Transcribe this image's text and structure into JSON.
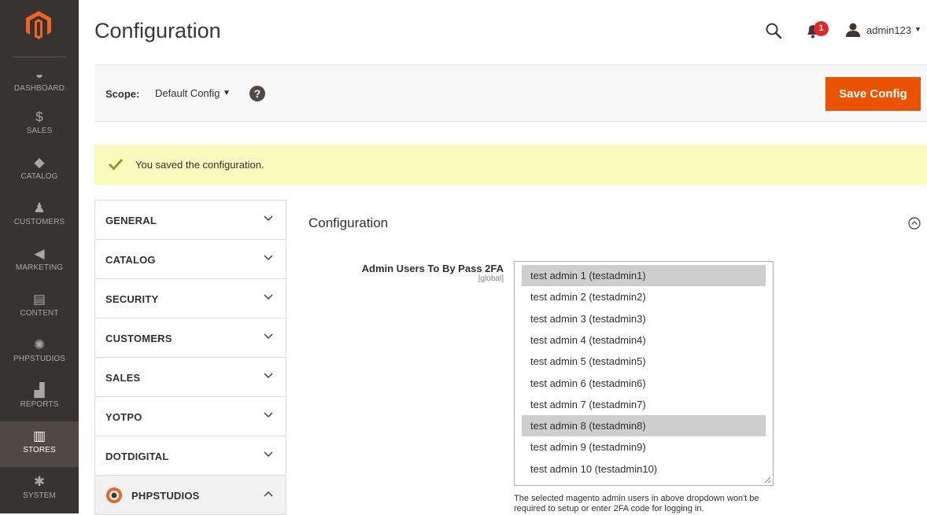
{
  "sidebar": {
    "logo": "magento-logo",
    "items": [
      {
        "label": "DASHBOARD",
        "icon": "dashboard-icon",
        "glyph": "◒"
      },
      {
        "label": "SALES",
        "icon": "dollar-icon",
        "glyph": "$"
      },
      {
        "label": "CATALOG",
        "icon": "box-icon",
        "glyph": "◆"
      },
      {
        "label": "CUSTOMERS",
        "icon": "person-icon",
        "glyph": "♟"
      },
      {
        "label": "MARKETING",
        "icon": "megaphone-icon",
        "glyph": "◀"
      },
      {
        "label": "CONTENT",
        "icon": "layout-icon",
        "glyph": "▤"
      },
      {
        "label": "PHPSTUDIOS",
        "icon": "phpstudios-icon",
        "glyph": "✺"
      },
      {
        "label": "REPORTS",
        "icon": "bar-chart-icon",
        "glyph": "▟"
      },
      {
        "label": "STORES",
        "icon": "store-icon",
        "glyph": "▥"
      },
      {
        "label": "SYSTEM",
        "icon": "gear-icon",
        "glyph": "✱"
      }
    ],
    "active": "STORES"
  },
  "header": {
    "title": "Configuration",
    "notification_count": "1",
    "username": "admin123"
  },
  "scope_bar": {
    "scope_label": "Scope:",
    "scope_value": "Default Config",
    "help_glyph": "?",
    "save_label": "Save Config"
  },
  "message": {
    "text": "You saved the configuration."
  },
  "tabs": [
    {
      "label": "GENERAL",
      "open": false
    },
    {
      "label": "CATALOG",
      "open": false
    },
    {
      "label": "SECURITY",
      "open": false
    },
    {
      "label": "CUSTOMERS",
      "open": false
    },
    {
      "label": "SALES",
      "open": false
    },
    {
      "label": "YOTPO",
      "open": false
    },
    {
      "label": "DOTDIGITAL",
      "open": false
    },
    {
      "label": "PHPSTUDIOS",
      "open": true
    }
  ],
  "section": {
    "title": "Configuration",
    "field_label": "Admin Users To By Pass 2FA",
    "field_scope": "[global]",
    "options": [
      {
        "label": "test admin 1 (testadmin1)",
        "selected": true
      },
      {
        "label": "test admin 2 (testadmin2)",
        "selected": false
      },
      {
        "label": "test admin 3 (testadmin3)",
        "selected": false
      },
      {
        "label": "test admin 4 (testadmin4)",
        "selected": false
      },
      {
        "label": "test admin 5 (testadmin5)",
        "selected": false
      },
      {
        "label": "test admin 6 (testadmin6)",
        "selected": false
      },
      {
        "label": "test admin 7 (testadmin7)",
        "selected": false
      },
      {
        "label": "test admin 8 (testadmin8)",
        "selected": true
      },
      {
        "label": "test admin 9 (testadmin9)",
        "selected": false
      },
      {
        "label": "test admin 10 (testadmin10)",
        "selected": false
      }
    ],
    "note": "The selected magento admin users in above dropdown won't be required to setup or enter 2FA code for logging in."
  },
  "colors": {
    "sidebar_bg": "#373330",
    "accent": "#eb5202",
    "success_bg": "#fafabc",
    "success_check": "#79a22e",
    "badge": "#e22626"
  }
}
